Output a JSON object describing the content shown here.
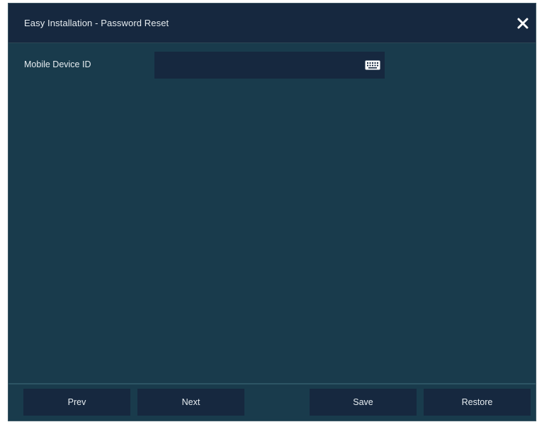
{
  "dialog": {
    "title": "Easy Installation - Password Reset",
    "close_icon": "close-icon"
  },
  "form": {
    "mobile_device_id": {
      "label": "Mobile Device ID",
      "value": "",
      "keyboard_icon": "keyboard-icon"
    }
  },
  "footer": {
    "prev_label": "Prev",
    "next_label": "Next",
    "save_label": "Save",
    "restore_label": "Restore"
  },
  "colors": {
    "dialog_bg": "#193b4c",
    "titlebar_bg": "#16283f",
    "control_bg": "#16283f",
    "text": "#e6ecf0",
    "footer_divider": "#2d5565"
  }
}
